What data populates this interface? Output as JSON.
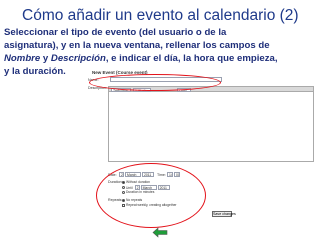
{
  "slide": {
    "title": "Cómo añadir un evento al calendario (2)",
    "text": {
      "line1": "Seleccionar el tipo de evento (del usuario o de la",
      "line2": "asignatura), y en la nueva ventana, rellenar los campos de",
      "line3_before": "",
      "line3_nombre": "Nombre",
      "line3_middle": " y ",
      "line3_descripcion": "Descripción",
      "line3_after": ", e indicar el día, la hora que empieza,",
      "line4": "y la duración."
    }
  },
  "screenshot": {
    "window_title": "New Event (Course event)",
    "name_label": "Name:",
    "description_label": "Description:",
    "toolbar_font": "Trebuchet",
    "toolbar_size": "1 (8 pt)",
    "toolbar_lang": "Lang",
    "date_label": "Date:",
    "date_day": "2",
    "date_month": "March",
    "date_year": "2011",
    "time_label": "Time:",
    "time_hour": "14",
    "time_min": "00",
    "duration_label": "Duration:",
    "duration_option1": "Without duration",
    "duration_option2": "Until",
    "duration_until_day": "2",
    "duration_until_month": "March",
    "duration_until_year": "2011",
    "duration_option3": "Duration in minutes",
    "repeat_label": "Repeats:",
    "repeat_option1": "No repeats",
    "repeat_option2": "Repeat weekly, creating altogether",
    "save_label": "Save changes"
  },
  "colors": {
    "title": "#1f3a8a",
    "text": "#1f2f7a",
    "highlight_ring": "#e3131b",
    "arrow_fill": "#1f9d3a",
    "arrow_border": "#555555"
  },
  "icons": {
    "nav": "left-arrow-icon"
  }
}
